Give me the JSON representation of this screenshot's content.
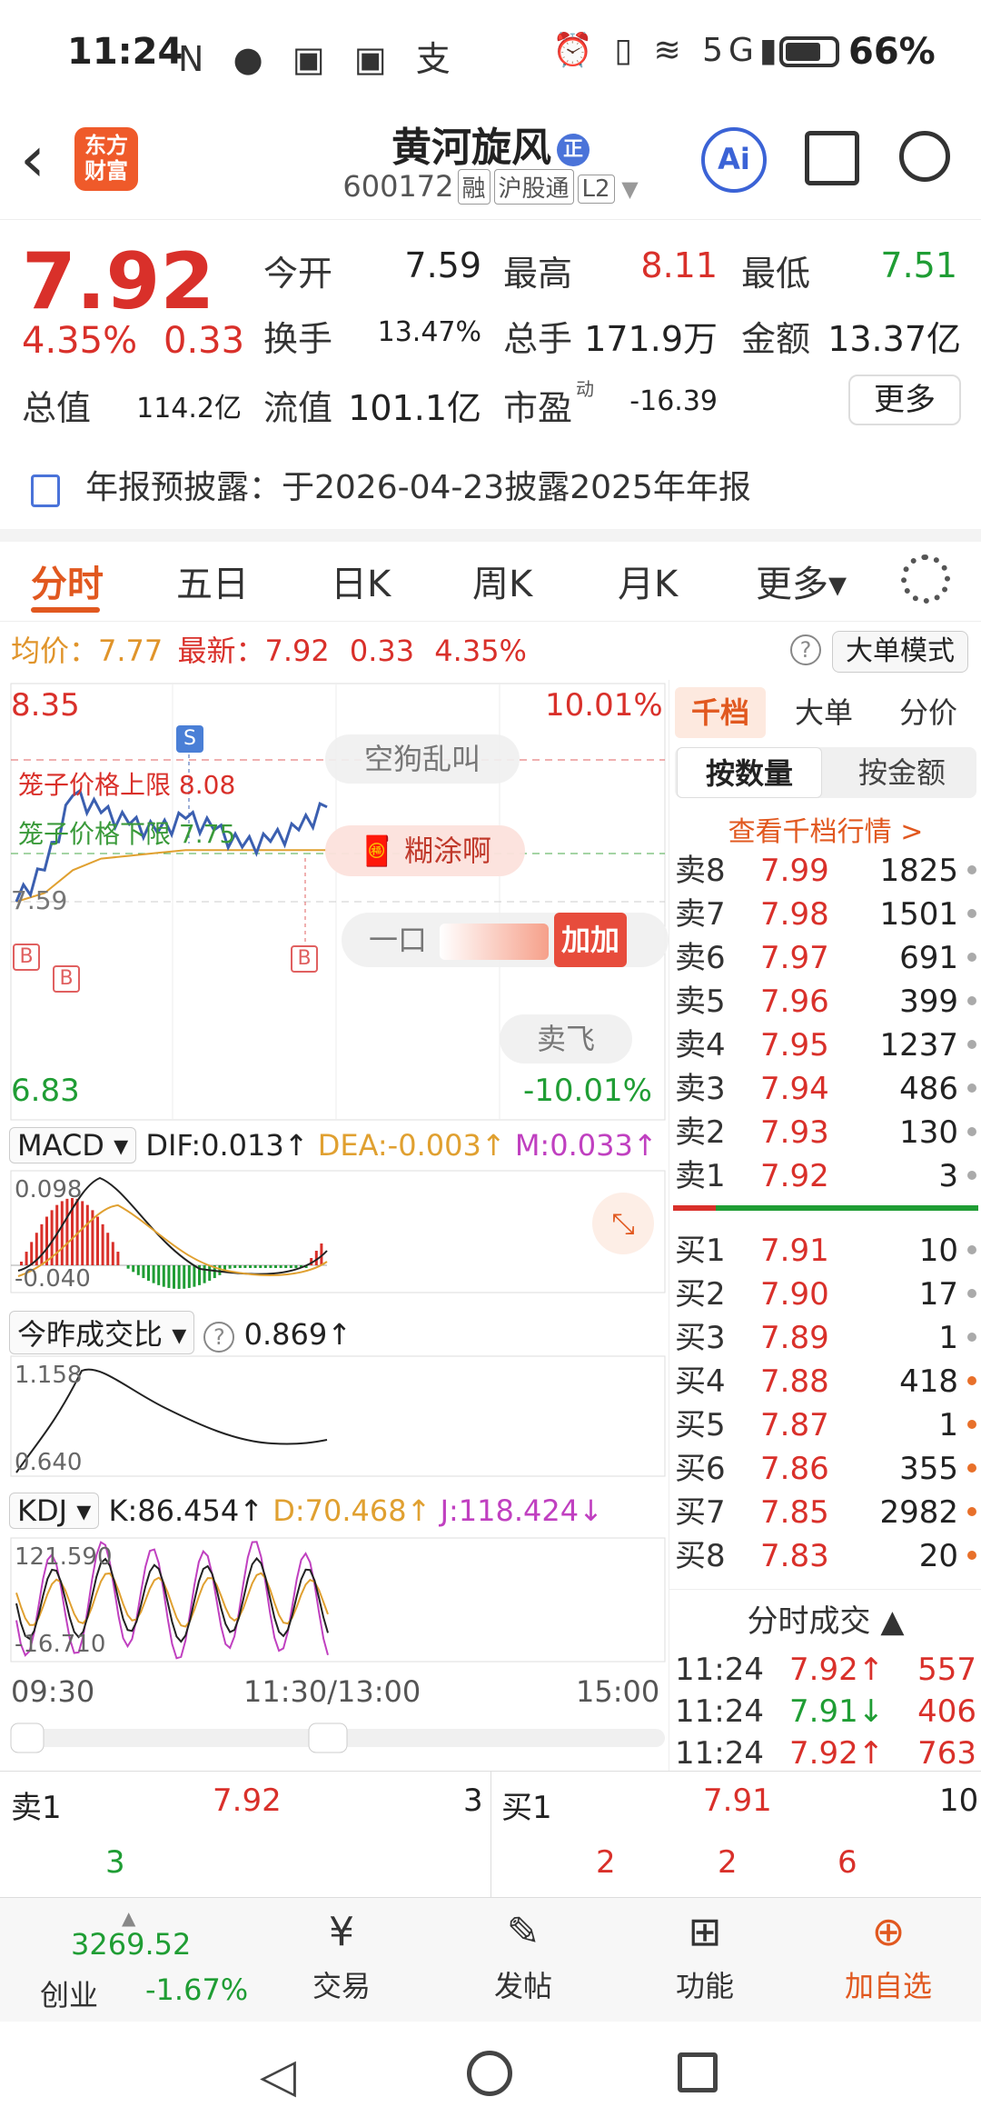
{
  "status_bar": {
    "time": "11:24",
    "left_icons": "N ● ▣ ▣ 支",
    "right_icons": "⏰ ▯ ≋ 5G▮",
    "battery": "66%",
    "battery_level": 0.66
  },
  "header": {
    "name": "黄河旋风",
    "name_badge": "正",
    "code": "600172",
    "tags": [
      "融",
      "沪股通",
      "L2"
    ],
    "logo_text": "东方财富",
    "ai_label": "Ai"
  },
  "quote": {
    "price": "7.92",
    "change_pct": "4.35%",
    "change": "0.33",
    "open_label": "今开",
    "open": "7.59",
    "high_label": "最高",
    "high": "8.11",
    "low_label": "最低",
    "low": "7.51",
    "turnover_label": "换手",
    "turnover": "13.47%",
    "volume_label": "总手",
    "volume": "171.9万",
    "amount_label": "金额",
    "amount": "13.37亿",
    "mktcap_label": "总值",
    "mktcap": "114.2亿",
    "float_label": "流值",
    "float": "101.1亿",
    "pe_label": "市盈",
    "pe_sup": "动",
    "pe": "-16.39",
    "more_label": "更多"
  },
  "notice": "年报预披露：于2026-04-23披露2025年年报",
  "tabs": [
    "分时",
    "五日",
    "日K",
    "周K",
    "月K",
    "更多▾"
  ],
  "avg_bar": {
    "avg_label": "均价：",
    "avg": "7.77",
    "latest_label": "最新：",
    "latest": "7.92",
    "chg": "0.33",
    "pct": "4.35%",
    "help": "?",
    "mode": "大单模式"
  },
  "chart": {
    "y_top": "8.35",
    "y_bottom": "6.83",
    "pct_top": "10.01%",
    "pct_bottom": "-10.01%",
    "upper_label": "笼子价格上限",
    "upper_val": "8.08",
    "lower_label": "笼子价格下限",
    "lower_val": "7.75",
    "left_mark": "7.59",
    "bubbles": [
      "空狗乱叫",
      "糊涂啊",
      "一口",
      "加加",
      "卖飞"
    ],
    "marker_s": "S",
    "marker_b": "B",
    "macd_sel": "MACD",
    "dif": "DIF:0.013↑",
    "dea": "DEA:-0.003↑",
    "m": "M:0.033↑",
    "macd_top": "0.098",
    "macd_bottom": "-0.040",
    "vr_sel": "今昨成交比",
    "vr_val": "0.869↑",
    "vr_top": "1.158",
    "vr_bottom": "0.640",
    "kdj_sel": "KDJ",
    "k": "K:86.454↑",
    "d": "D:70.468↑",
    "j": "J:118.424↓",
    "kdj_top": "121.590",
    "kdj_bottom": "-16.710",
    "time_start": "09:30",
    "time_mid": "11:30/13:00",
    "time_end": "15:00"
  },
  "chart_data": {
    "type": "line",
    "title": "",
    "ylim": [
      6.83,
      8.35
    ],
    "x": [
      "09:30",
      "11:30/13:00",
      "15:00"
    ],
    "series": [
      {
        "values": [
          7.59,
          7.7,
          7.96,
          7.9,
          7.86,
          7.83,
          7.88,
          7.84,
          7.78,
          7.8,
          7.84,
          7.92
        ]
      },
      {
        "values": [
          7.59,
          7.62,
          7.7,
          7.74,
          7.75,
          7.76,
          7.77,
          7.77,
          7.77,
          7.77,
          7.77,
          7.77
        ]
      }
    ]
  },
  "book": {
    "tabs": [
      "千档",
      "大单",
      "分价"
    ],
    "segs": [
      "按数量",
      "按金额"
    ],
    "link": "查看千档行情 >",
    "asks": [
      {
        "label": "卖8",
        "price": "7.99",
        "qty": "1825"
      },
      {
        "label": "卖7",
        "price": "7.98",
        "qty": "1501"
      },
      {
        "label": "卖6",
        "price": "7.97",
        "qty": "691"
      },
      {
        "label": "卖5",
        "price": "7.96",
        "qty": "399"
      },
      {
        "label": "卖4",
        "price": "7.95",
        "qty": "1237"
      },
      {
        "label": "卖3",
        "price": "7.94",
        "qty": "486"
      },
      {
        "label": "卖2",
        "price": "7.93",
        "qty": "130"
      },
      {
        "label": "卖1",
        "price": "7.92",
        "qty": "3"
      }
    ],
    "bids": [
      {
        "label": "买1",
        "price": "7.91",
        "qty": "10"
      },
      {
        "label": "买2",
        "price": "7.90",
        "qty": "17"
      },
      {
        "label": "买3",
        "price": "7.89",
        "qty": "1"
      },
      {
        "label": "买4",
        "price": "7.88",
        "qty": "418"
      },
      {
        "label": "买5",
        "price": "7.87",
        "qty": "1"
      },
      {
        "label": "买6",
        "price": "7.86",
        "qty": "355"
      },
      {
        "label": "买7",
        "price": "7.85",
        "qty": "2982"
      },
      {
        "label": "买8",
        "price": "7.83",
        "qty": "20"
      }
    ],
    "ticks_title": "分时成交 ▲",
    "ticks": [
      {
        "time": "11:24",
        "price": "7.92↑",
        "vol": "557",
        "dir": "up"
      },
      {
        "time": "11:24",
        "price": "7.91↓",
        "vol": "406",
        "dir": "down"
      },
      {
        "time": "11:24",
        "price": "7.92↑",
        "vol": "763",
        "dir": "up"
      }
    ]
  },
  "summary": {
    "ask_label": "卖1",
    "ask_price": "7.92",
    "ask_qty": "3",
    "ask_detail": "3",
    "bid_label": "买1",
    "bid_price": "7.91",
    "bid_qty": "10",
    "bid_details": [
      "2",
      "2",
      "6"
    ]
  },
  "bottom_nav": {
    "index_value": "3269.52",
    "index_name": "创业",
    "index_pct": "-1.67%",
    "trade": "交易",
    "post": "发帖",
    "func": "功能",
    "add": "加自选"
  }
}
